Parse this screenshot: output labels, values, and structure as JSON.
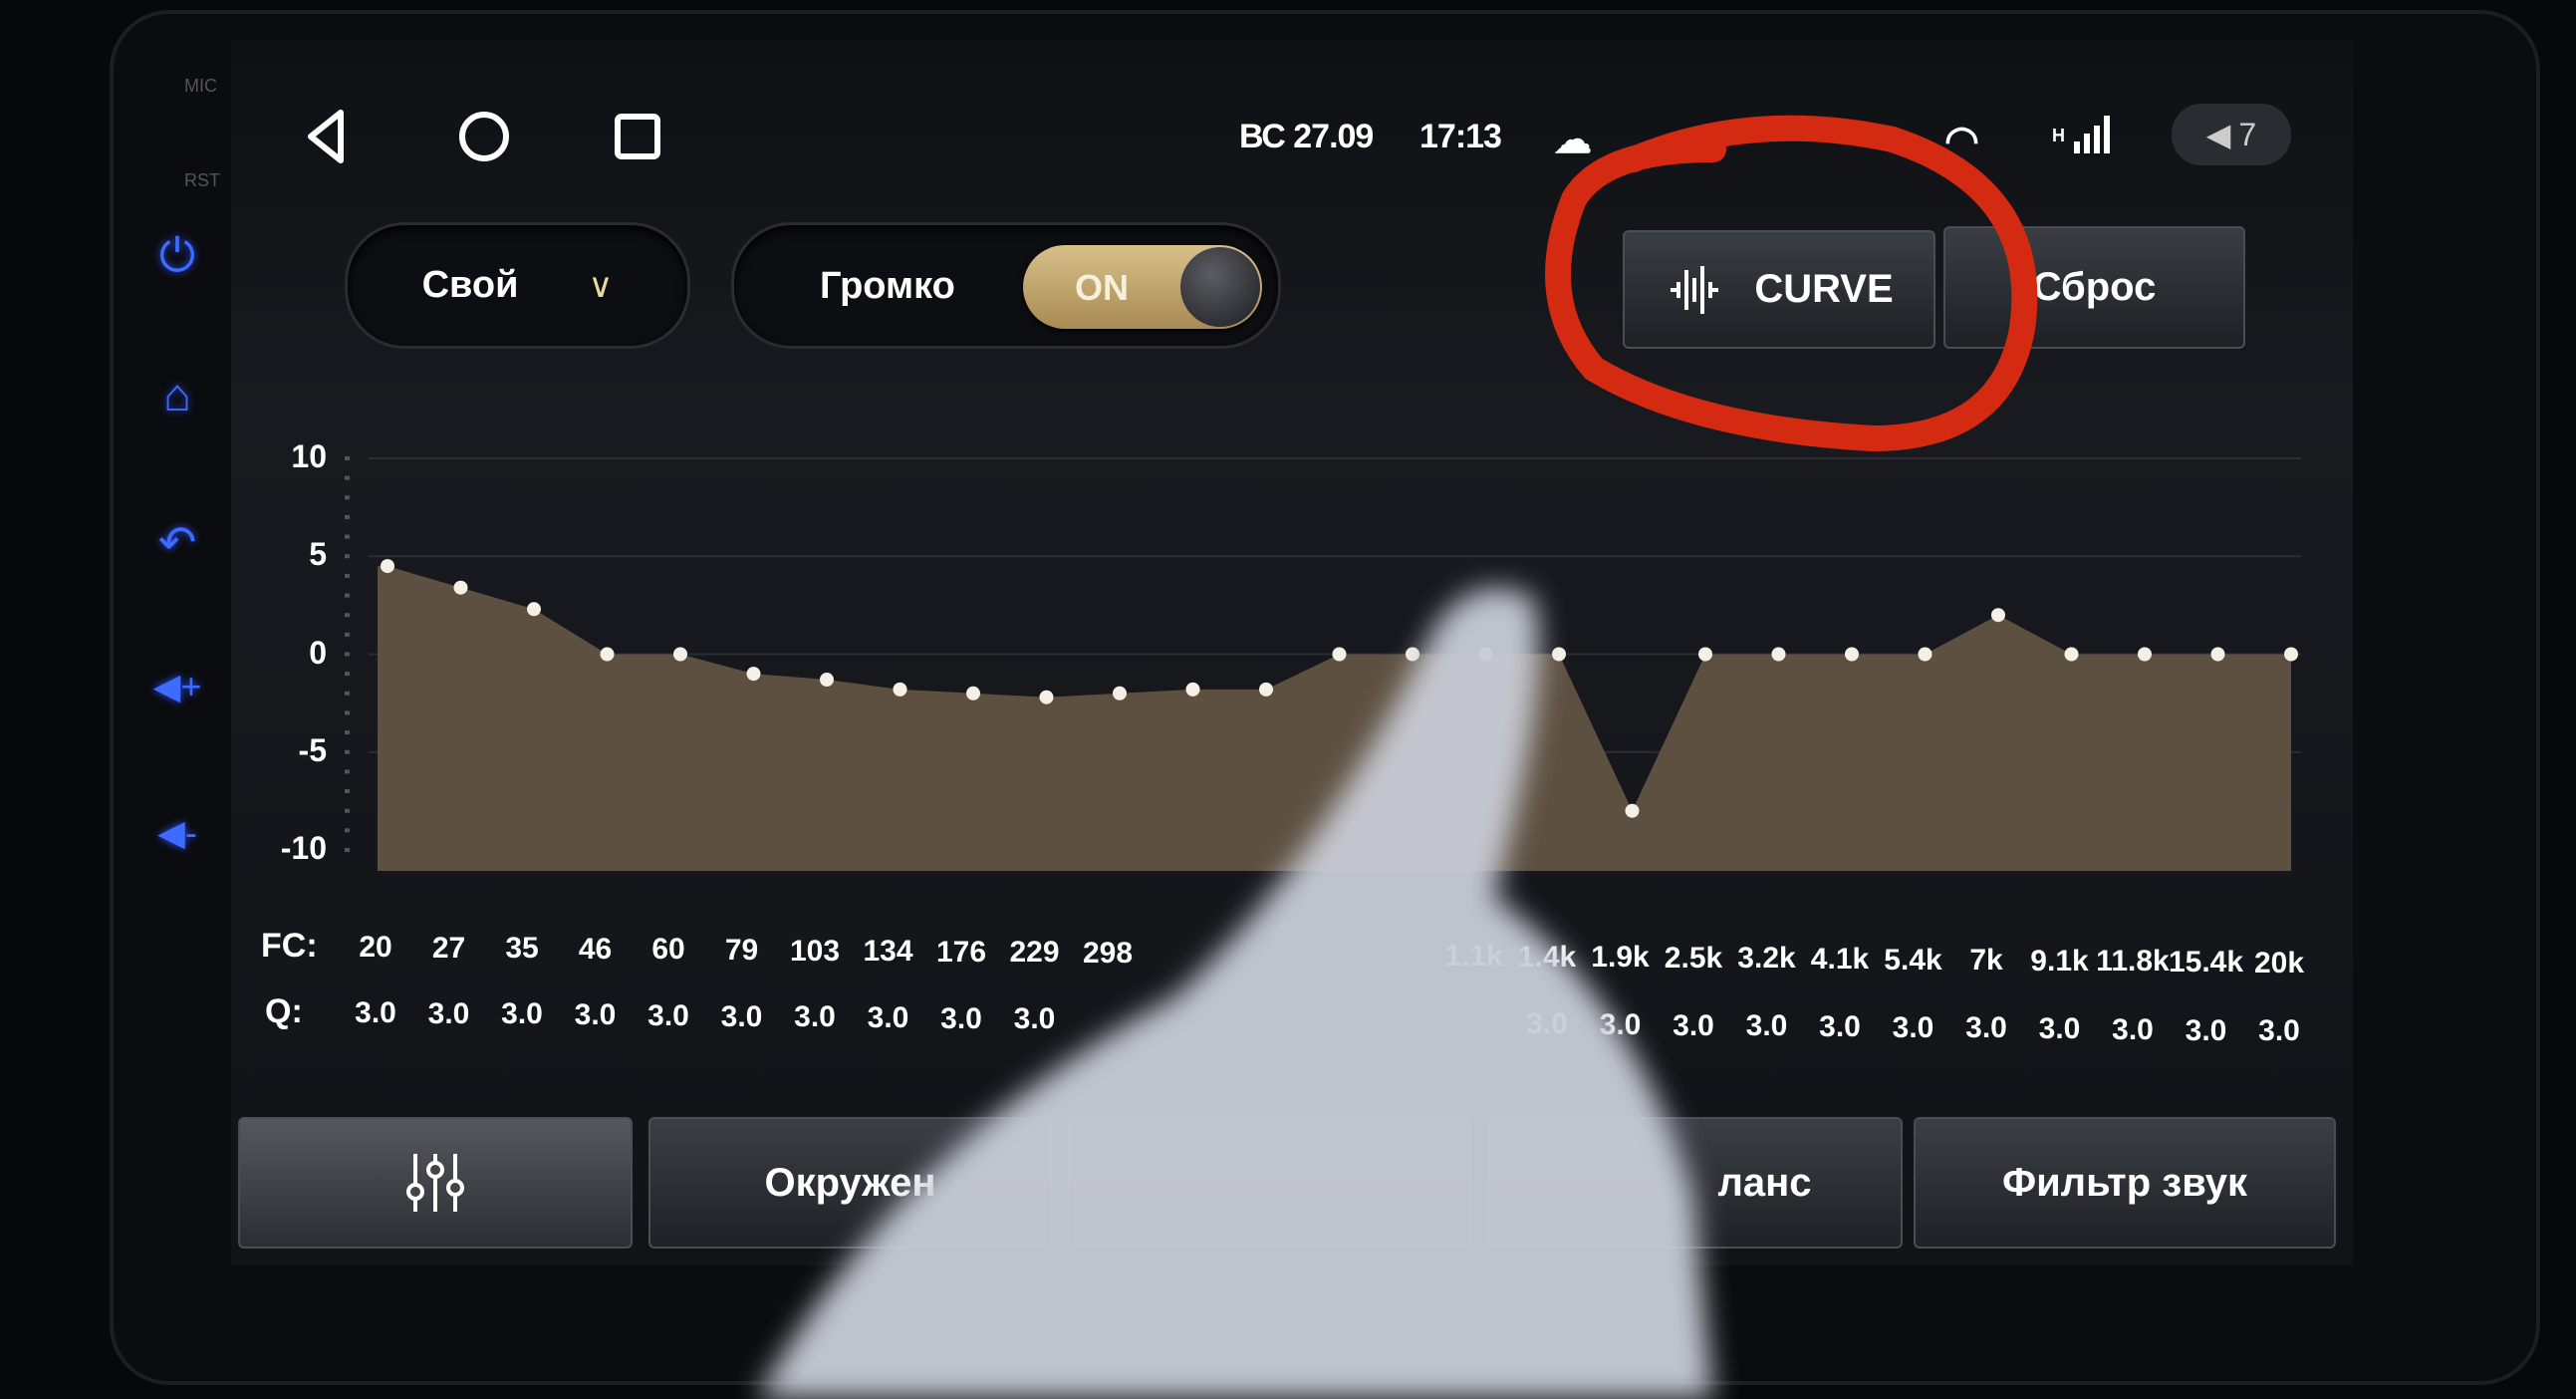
{
  "bezel": {
    "mic_label": "MIC",
    "rst_label": "RST"
  },
  "status_bar": {
    "date": "ВС 27.09",
    "time": "17:13",
    "volume": "7"
  },
  "controls": {
    "preset": "Свой",
    "loudness_label": "Громко",
    "loudness_toggle": "ON",
    "loudness_on": true,
    "curve_label": "CURVE",
    "reset_label": "Сброс"
  },
  "annotation": {
    "color": "#d42a12"
  },
  "chart_data": {
    "type": "area",
    "ylim": [
      -10,
      10
    ],
    "yticks": [
      "10",
      "5",
      "0",
      "-5",
      "-10"
    ],
    "fc_label": "FC:",
    "q_label": "Q:",
    "x": [
      "20",
      "27",
      "35",
      "46",
      "60",
      "79",
      "103",
      "134",
      "176",
      "229",
      "298",
      null,
      null,
      null,
      null,
      "1.1k",
      "1.4k",
      "1.9k",
      "2.5k",
      "3.2k",
      "4.1k",
      "5.4k",
      "7k",
      "9.1k",
      "11.8k",
      "15.4k",
      "20k"
    ],
    "q": [
      "3.0",
      "3.0",
      "3.0",
      "3.0",
      "3.0",
      "3.0",
      "3.0",
      "3.0",
      "3.0",
      "3.0",
      null,
      null,
      null,
      null,
      null,
      null,
      "3.0",
      "3.0",
      "3.0",
      "3.0",
      "3.0",
      "3.0",
      "3.0",
      "3.0",
      "3.0",
      "3.0",
      "3.0"
    ],
    "values": [
      4.5,
      3.4,
      2.3,
      0,
      0,
      -1,
      -1.3,
      -1.8,
      -2,
      -2.2,
      -2,
      -1.8,
      -1.8,
      0,
      0,
      0,
      0,
      -8,
      0,
      0,
      0,
      0,
      2,
      0,
      0,
      0,
      0
    ],
    "fill_color": "#5e5041",
    "point_color": "#f4f0e6"
  },
  "tabs": [
    {
      "label": ""
    },
    {
      "label": "Окружен"
    },
    {
      "label": ""
    },
    {
      "label": "ланс"
    },
    {
      "label": "Фильтр звук"
    }
  ]
}
